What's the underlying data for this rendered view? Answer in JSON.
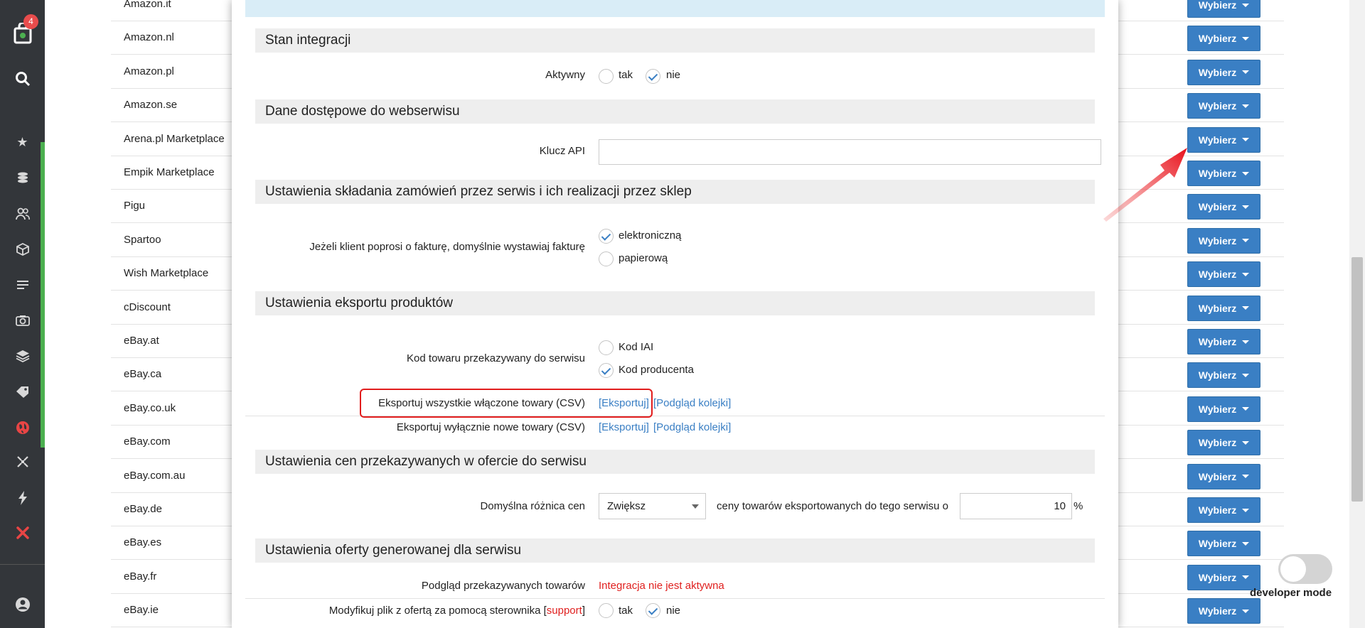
{
  "sidebar": {
    "cart_badge": "4",
    "icons": [
      "cart-icon",
      "search-icon",
      "star-icon",
      "coins-icon",
      "users-icon",
      "box-icon",
      "orders-icon",
      "camera-icon",
      "layers-icon",
      "tag-icon",
      "globe-icon",
      "integrations-icon",
      "lightning-icon",
      "tools-icon",
      "account-icon"
    ]
  },
  "marketplaces": [
    {
      "name": "Amazon.it",
      "button": "Wybierz"
    },
    {
      "name": "Amazon.nl",
      "button": "Wybierz"
    },
    {
      "name": "Amazon.pl",
      "button": "Wybierz"
    },
    {
      "name": "Amazon.se",
      "button": "Wybierz"
    },
    {
      "name": "Arena.pl Marketplace",
      "button": "Wybierz"
    },
    {
      "name": "Empik Marketplace",
      "button": "Wybierz"
    },
    {
      "name": "Pigu",
      "button": "Wybierz"
    },
    {
      "name": "Spartoo",
      "button": "Wybierz"
    },
    {
      "name": "Wish Marketplace",
      "button": "Wybierz"
    },
    {
      "name": "cDiscount",
      "button": "Wybierz"
    },
    {
      "name": "eBay.at",
      "button": "Wybierz"
    },
    {
      "name": "eBay.ca",
      "button": "Wybierz"
    },
    {
      "name": "eBay.co.uk",
      "button": "Wybierz"
    },
    {
      "name": "eBay.com",
      "button": "Wybierz"
    },
    {
      "name": "eBay.com.au",
      "button": "Wybierz"
    },
    {
      "name": "eBay.de",
      "button": "Wybierz"
    },
    {
      "name": "eBay.es",
      "button": "Wybierz"
    },
    {
      "name": "eBay.fr",
      "button": "Wybierz"
    },
    {
      "name": "eBay.ie",
      "button": "Wybierz"
    }
  ],
  "developer_mode": {
    "label": "developer mode",
    "enabled": false
  },
  "modal": {
    "section_status": "Stan integracji",
    "active_label": "Aktywny",
    "active_yes": "tak",
    "active_no": "nie",
    "active_value": "nie",
    "section_access": "Dane dostępowe do webserwisu",
    "api_key_label": "Klucz API",
    "api_key_value": "",
    "section_orders": "Ustawienia składania zamówień przez serwis i ich realizacji przez sklep",
    "invoice_label": "Jeżeli klient poprosi o fakturę, domyślnie wystawiaj fakturę",
    "invoice_electronic": "elektroniczną",
    "invoice_paper": "papierową",
    "invoice_value": "elektroniczną",
    "section_export": "Ustawienia eksportu produktów",
    "product_code_label": "Kod towaru przekazywany do serwisu",
    "code_iai": "Kod IAI",
    "code_producer": "Kod producenta",
    "product_code_value": "Kod producenta",
    "export_all_label": "Eksportuj wszystkie włączone towary (CSV)",
    "export_new_label": "Eksportuj wyłącznie nowe towary (CSV)",
    "export_link": "[Eksportuj]",
    "queue_link": "[Podgląd kolejki]",
    "section_prices": "Ustawienia cen przekazywanych w ofercie do serwisu",
    "price_diff_label": "Domyślna różnica cen",
    "price_diff_select": "Zwiększ",
    "price_diff_text": "ceny towarów eksportowanych do tego serwisu o",
    "price_diff_value": "10",
    "price_diff_unit": "%",
    "section_offer": "Ustawienia oferty generowanej dla serwisu",
    "preview_label": "Podgląd przekazywanych towarów",
    "preview_value": "Integracja nie jest aktywna",
    "modify_label_pre": "Modyfikuj plik z ofertą za pomocą sterownika [",
    "modify_label_link": "support",
    "modify_label_post": "]",
    "modify_yes": "tak",
    "modify_no": "nie",
    "modify_value": "nie"
  },
  "colors": {
    "accent": "#3a7fc4",
    "highlight": "#e11d1d",
    "sidebar": "#33363a",
    "active_green": "#4cb050"
  }
}
